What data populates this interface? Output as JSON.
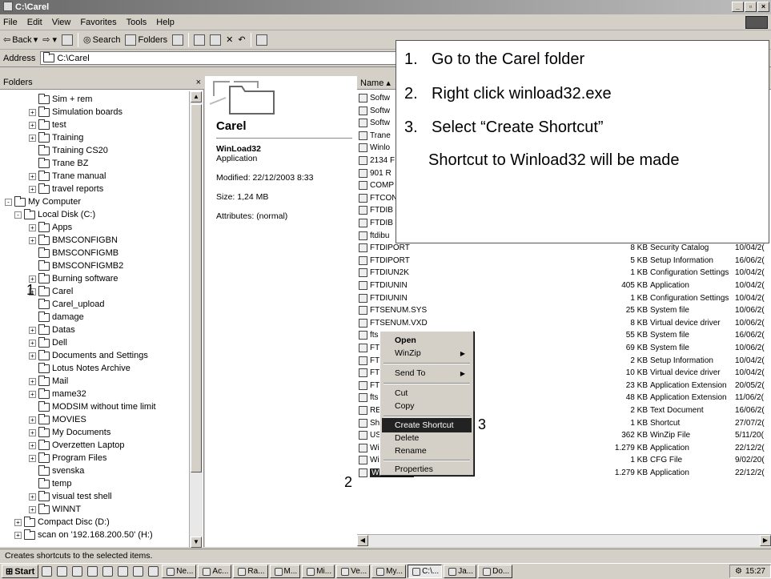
{
  "window": {
    "title": "C:\\Carel"
  },
  "menu": [
    "File",
    "Edit",
    "View",
    "Favorites",
    "Tools",
    "Help"
  ],
  "toolbar": {
    "back": "Back",
    "search": "Search",
    "folders": "Folders"
  },
  "address": {
    "label": "Address",
    "value": "C:\\Carel"
  },
  "folders_pane": {
    "title": "Folders",
    "close": "×"
  },
  "tree": [
    {
      "label": "Sim + rem",
      "indent": 2,
      "exp": ""
    },
    {
      "label": "Simulation boards",
      "indent": 2,
      "exp": "+"
    },
    {
      "label": "test",
      "indent": 2,
      "exp": "+"
    },
    {
      "label": "Training",
      "indent": 2,
      "exp": "+"
    },
    {
      "label": "Training CS20",
      "indent": 2,
      "exp": ""
    },
    {
      "label": "Trane BZ",
      "indent": 2,
      "exp": ""
    },
    {
      "label": "Trane manual",
      "indent": 2,
      "exp": "+"
    },
    {
      "label": "travel reports",
      "indent": 2,
      "exp": "+"
    },
    {
      "label": "My Computer",
      "indent": 0,
      "exp": "-"
    },
    {
      "label": "Local Disk (C:)",
      "indent": 1,
      "exp": "-"
    },
    {
      "label": "Apps",
      "indent": 2,
      "exp": "+"
    },
    {
      "label": "BMSCONFIGBN",
      "indent": 2,
      "exp": "+"
    },
    {
      "label": "BMSCONFIGMB",
      "indent": 2,
      "exp": ""
    },
    {
      "label": "BMSCONFIGMB2",
      "indent": 2,
      "exp": ""
    },
    {
      "label": "Burning software",
      "indent": 2,
      "exp": "+"
    },
    {
      "label": "Carel",
      "indent": 2,
      "exp": "+"
    },
    {
      "label": "Carel_upload",
      "indent": 2,
      "exp": ""
    },
    {
      "label": "damage",
      "indent": 2,
      "exp": ""
    },
    {
      "label": "Datas",
      "indent": 2,
      "exp": "+"
    },
    {
      "label": "Dell",
      "indent": 2,
      "exp": "+"
    },
    {
      "label": "Documents and Settings",
      "indent": 2,
      "exp": "+"
    },
    {
      "label": "Lotus Notes Archive",
      "indent": 2,
      "exp": ""
    },
    {
      "label": "Mail",
      "indent": 2,
      "exp": "+"
    },
    {
      "label": "mame32",
      "indent": 2,
      "exp": "+"
    },
    {
      "label": "MODSIM without time limit",
      "indent": 2,
      "exp": ""
    },
    {
      "label": "MOVIES",
      "indent": 2,
      "exp": "+"
    },
    {
      "label": "My Documents",
      "indent": 2,
      "exp": "+"
    },
    {
      "label": "Overzetten Laptop",
      "indent": 2,
      "exp": "+"
    },
    {
      "label": "Program Files",
      "indent": 2,
      "exp": "+"
    },
    {
      "label": "svenska",
      "indent": 2,
      "exp": ""
    },
    {
      "label": "temp",
      "indent": 2,
      "exp": ""
    },
    {
      "label": "visual test shell",
      "indent": 2,
      "exp": "+"
    },
    {
      "label": "WINNT",
      "indent": 2,
      "exp": "+"
    },
    {
      "label": "Compact Disc (D:)",
      "indent": 1,
      "exp": "+"
    },
    {
      "label": "scan on '192.168.200.50' (H:)",
      "indent": 1,
      "exp": "+"
    }
  ],
  "details": {
    "folder": "Carel",
    "name": "WinLoad32",
    "type": "Application",
    "modified": "Modified: 22/12/2003 8:33",
    "size": "Size: 1,24 MB",
    "attributes": "Attributes: (normal)"
  },
  "list_header": "Name",
  "files": [
    {
      "name": "Softw",
      "size": "",
      "type": "",
      "date": ""
    },
    {
      "name": "Softw",
      "size": "",
      "type": "",
      "date": ""
    },
    {
      "name": "Softw",
      "size": "",
      "type": "",
      "date": ""
    },
    {
      "name": "Trane",
      "size": "",
      "type": "",
      "date": ""
    },
    {
      "name": "Winlo",
      "size": "",
      "type": "",
      "date": ""
    },
    {
      "name": "2134 F",
      "size": "",
      "type": "",
      "date": ""
    },
    {
      "name": "901 R",
      "size": "",
      "type": "",
      "date": ""
    },
    {
      "name": "COMP",
      "size": "",
      "type": "",
      "date": ""
    },
    {
      "name": "FTCON",
      "size": "",
      "type": "",
      "date": ""
    },
    {
      "name": "FTDIB",
      "size": "",
      "type": "",
      "date": ""
    },
    {
      "name": "FTDIB",
      "size": "",
      "type": "",
      "date": ""
    },
    {
      "name": "ftdibu",
      "size": "",
      "type": "",
      "date": ""
    },
    {
      "name": "FTDIPORT",
      "size": "8 KB",
      "type": "Security Catalog",
      "date": "10/04/2("
    },
    {
      "name": "FTDIPORT",
      "size": "5 KB",
      "type": "Setup Information",
      "date": "16/06/2("
    },
    {
      "name": "FTDIUN2K",
      "size": "1 KB",
      "type": "Configuration Settings",
      "date": "10/04/2("
    },
    {
      "name": "FTDIUNIN",
      "size": "405 KB",
      "type": "Application",
      "date": "10/04/2("
    },
    {
      "name": "FTDIUNIN",
      "size": "1 KB",
      "type": "Configuration Settings",
      "date": "10/04/2("
    },
    {
      "name": "FTSENUM.SYS",
      "size": "25 KB",
      "type": "System file",
      "date": "10/06/2("
    },
    {
      "name": "FTSENUM.VXD",
      "size": "8 KB",
      "type": "Virtual device driver",
      "date": "10/06/2("
    },
    {
      "name": "fts",
      "size": "55 KB",
      "type": "System file",
      "date": "16/06/2("
    },
    {
      "name": "FT",
      "size": "69 KB",
      "type": "System file",
      "date": "10/06/2("
    },
    {
      "name": "FT",
      "size": "2 KB",
      "type": "Setup Information",
      "date": "10/04/2("
    },
    {
      "name": "FT",
      "size": "10 KB",
      "type": "Virtual device driver",
      "date": "10/04/2("
    },
    {
      "name": "FT",
      "size": "23 KB",
      "type": "Application Extension",
      "date": "20/05/2("
    },
    {
      "name": "fts",
      "size": "48 KB",
      "type": "Application Extension",
      "date": "11/06/2("
    },
    {
      "name": "RE",
      "size": "2 KB",
      "type": "Text Document",
      "date": "16/06/2("
    },
    {
      "name": "Sh",
      "size": "1 KB",
      "type": "Shortcut",
      "date": "27/07/2("
    },
    {
      "name": "US",
      "size": "362 KB",
      "type": "WinZip File",
      "date": "5/11/20("
    },
    {
      "name": "Wi",
      "size": "1.279 KB",
      "type": "Application",
      "date": "22/12/2("
    },
    {
      "name": "Wi",
      "size": "1 KB",
      "type": "CFG File",
      "date": "9/02/20("
    },
    {
      "name": "WinLoad32",
      "size": "1.279 KB",
      "type": "Application",
      "date": "22/12/2("
    }
  ],
  "context_menu": {
    "open": "Open",
    "winzip": "WinZip",
    "send_to": "Send To",
    "cut": "Cut",
    "copy": "Copy",
    "create_shortcut": "Create Shortcut",
    "delete": "Delete",
    "rename": "Rename",
    "properties": "Properties"
  },
  "callout": {
    "step1": "Go to the Carel folder",
    "step2": "Right click winload32.exe",
    "step3": "Select “Create Shortcut”",
    "note": "Shortcut to Winload32 will be made",
    "n1": "1.",
    "n2": "2.",
    "n3": "3."
  },
  "markers": {
    "one": "1",
    "two": "2",
    "three": "3"
  },
  "status": "Creates shortcuts to the selected items.",
  "taskbar": {
    "start": "Start",
    "items": [
      "Ne...",
      "Ac...",
      "Ra...",
      "M...",
      "Mi...",
      "Ve...",
      "My...",
      "C:\\...",
      "Ja...",
      "Do..."
    ],
    "clock": "15:27"
  }
}
